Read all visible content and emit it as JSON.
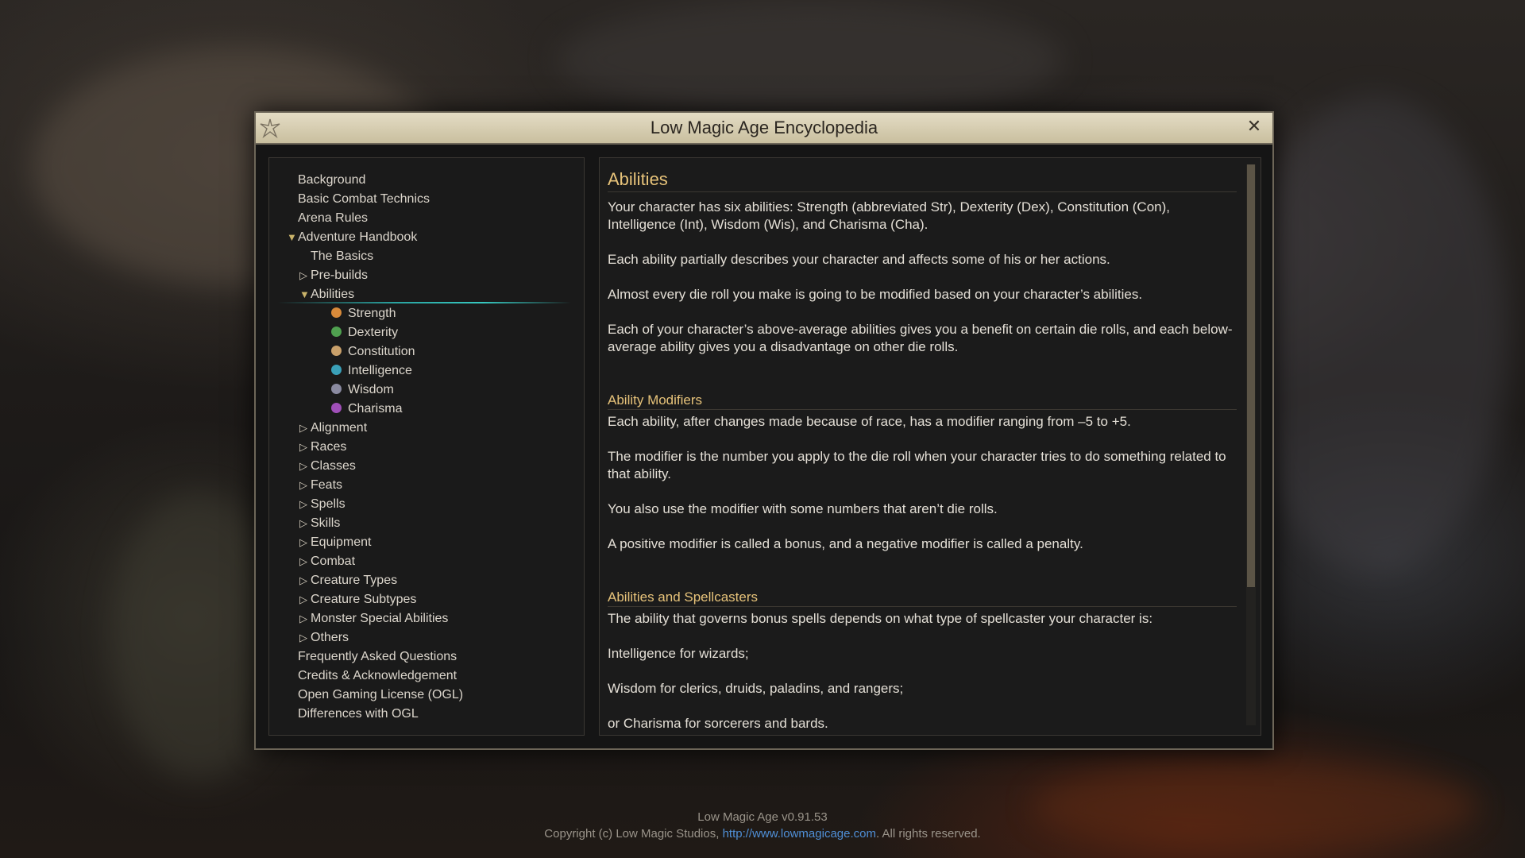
{
  "window": {
    "title": "Low Magic Age Encyclopedia",
    "close_symbol": "✕"
  },
  "nav": {
    "items": [
      {
        "label": "Background",
        "level": 0,
        "arrow": ""
      },
      {
        "label": "Basic Combat Technics",
        "level": 0,
        "arrow": ""
      },
      {
        "label": "Arena Rules",
        "level": 0,
        "arrow": ""
      },
      {
        "label": "Adventure Handbook",
        "level": 0,
        "arrow": "▼"
      },
      {
        "label": "The Basics",
        "level": 1,
        "arrow": ""
      },
      {
        "label": "Pre-builds",
        "level": 1,
        "arrow": "▷"
      },
      {
        "label": "Abilities",
        "level": 1,
        "arrow": "▼",
        "selected": true
      },
      {
        "label": "Strength",
        "level": 2,
        "icon": "strength-icon"
      },
      {
        "label": "Dexterity",
        "level": 2,
        "icon": "dexterity-icon"
      },
      {
        "label": "Constitution",
        "level": 2,
        "icon": "constitution-icon"
      },
      {
        "label": "Intelligence",
        "level": 2,
        "icon": "intelligence-icon"
      },
      {
        "label": "Wisdom",
        "level": 2,
        "icon": "wisdom-icon"
      },
      {
        "label": "Charisma",
        "level": 2,
        "icon": "charisma-icon"
      },
      {
        "label": "Alignment",
        "level": 1,
        "arrow": "▷"
      },
      {
        "label": "Races",
        "level": 1,
        "arrow": "▷"
      },
      {
        "label": "Classes",
        "level": 1,
        "arrow": "▷"
      },
      {
        "label": "Feats",
        "level": 1,
        "arrow": "▷"
      },
      {
        "label": "Spells",
        "level": 1,
        "arrow": "▷"
      },
      {
        "label": "Skills",
        "level": 1,
        "arrow": "▷"
      },
      {
        "label": "Equipment",
        "level": 1,
        "arrow": "▷"
      },
      {
        "label": "Combat",
        "level": 1,
        "arrow": "▷"
      },
      {
        "label": "Creature Types",
        "level": 1,
        "arrow": "▷"
      },
      {
        "label": "Creature Subtypes",
        "level": 1,
        "arrow": "▷"
      },
      {
        "label": "Monster Special Abilities",
        "level": 1,
        "arrow": "▷"
      },
      {
        "label": "Others",
        "level": 1,
        "arrow": "▷"
      },
      {
        "label": "Frequently Asked Questions",
        "level": 0,
        "arrow": ""
      },
      {
        "label": "Credits & Acknowledgement",
        "level": 0,
        "arrow": ""
      },
      {
        "label": "Open Gaming License (OGL)",
        "level": 0,
        "arrow": ""
      },
      {
        "label": "Differences with OGL",
        "level": 0,
        "arrow": ""
      }
    ]
  },
  "content": {
    "title": "Abilities",
    "intro": [
      "Your character has six abilities: Strength (abbreviated Str), Dexterity (Dex), Constitution (Con), Intelligence (Int), Wisdom (Wis), and Charisma (Cha).",
      "Each ability partially describes your character and affects some of his or her actions.",
      "Almost every die roll you make is going to be modified based on your character’s abilities.",
      "Each of your character’s above-average abilities gives you a benefit on certain die rolls, and each below-average ability gives you a disadvantage on other die rolls."
    ],
    "section1_title": "Ability Modifiers",
    "section1": [
      "Each ability, after changes made because of race, has a modifier ranging from –5 to +5.",
      "The modifier is the number you apply to the die roll when your character tries to do something related to that ability.",
      "You also use the modifier with some numbers that aren’t die rolls.",
      "A positive modifier is called a bonus, and a negative modifier is called a penalty."
    ],
    "section2_title": "Abilities and Spellcasters",
    "section2": [
      "The ability that governs bonus spells depends on what type of spellcaster your character is:",
      "Intelligence for wizards;",
      "Wisdom for clerics, druids, paladins, and rangers;",
      "or Charisma for sorcerers and bards."
    ]
  },
  "footer": {
    "version": "Low Magic Age v0.91.53",
    "copyright_prefix": "Copyright (c) Low Magic Studios, ",
    "link": "http://www.lowmagicage.com",
    "copyright_suffix": ". All rights reserved."
  },
  "colors": {
    "accent_gold": "#e7c37a",
    "titlebar": "#d8cfb2",
    "selection_teal": "#37c8c0",
    "link_blue": "#4f8fd6"
  }
}
